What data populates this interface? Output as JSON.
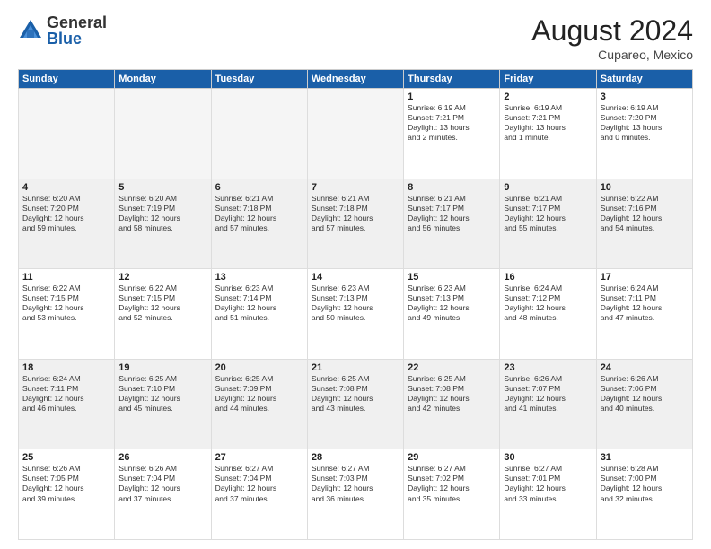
{
  "logo": {
    "general": "General",
    "blue": "Blue"
  },
  "header": {
    "month": "August 2024",
    "location": "Cupareo, Mexico"
  },
  "weekdays": [
    "Sunday",
    "Monday",
    "Tuesday",
    "Wednesday",
    "Thursday",
    "Friday",
    "Saturday"
  ],
  "weeks": [
    [
      {
        "day": "",
        "empty": true
      },
      {
        "day": "",
        "empty": true
      },
      {
        "day": "",
        "empty": true
      },
      {
        "day": "",
        "empty": true
      },
      {
        "day": "1",
        "info": "Sunrise: 6:19 AM\nSunset: 7:21 PM\nDaylight: 13 hours\nand 2 minutes."
      },
      {
        "day": "2",
        "info": "Sunrise: 6:19 AM\nSunset: 7:21 PM\nDaylight: 13 hours\nand 1 minute."
      },
      {
        "day": "3",
        "info": "Sunrise: 6:19 AM\nSunset: 7:20 PM\nDaylight: 13 hours\nand 0 minutes."
      }
    ],
    [
      {
        "day": "4",
        "info": "Sunrise: 6:20 AM\nSunset: 7:20 PM\nDaylight: 12 hours\nand 59 minutes.",
        "shaded": true
      },
      {
        "day": "5",
        "info": "Sunrise: 6:20 AM\nSunset: 7:19 PM\nDaylight: 12 hours\nand 58 minutes.",
        "shaded": true
      },
      {
        "day": "6",
        "info": "Sunrise: 6:21 AM\nSunset: 7:18 PM\nDaylight: 12 hours\nand 57 minutes.",
        "shaded": true
      },
      {
        "day": "7",
        "info": "Sunrise: 6:21 AM\nSunset: 7:18 PM\nDaylight: 12 hours\nand 57 minutes.",
        "shaded": true
      },
      {
        "day": "8",
        "info": "Sunrise: 6:21 AM\nSunset: 7:17 PM\nDaylight: 12 hours\nand 56 minutes.",
        "shaded": true
      },
      {
        "day": "9",
        "info": "Sunrise: 6:21 AM\nSunset: 7:17 PM\nDaylight: 12 hours\nand 55 minutes.",
        "shaded": true
      },
      {
        "day": "10",
        "info": "Sunrise: 6:22 AM\nSunset: 7:16 PM\nDaylight: 12 hours\nand 54 minutes.",
        "shaded": true
      }
    ],
    [
      {
        "day": "11",
        "info": "Sunrise: 6:22 AM\nSunset: 7:15 PM\nDaylight: 12 hours\nand 53 minutes."
      },
      {
        "day": "12",
        "info": "Sunrise: 6:22 AM\nSunset: 7:15 PM\nDaylight: 12 hours\nand 52 minutes."
      },
      {
        "day": "13",
        "info": "Sunrise: 6:23 AM\nSunset: 7:14 PM\nDaylight: 12 hours\nand 51 minutes."
      },
      {
        "day": "14",
        "info": "Sunrise: 6:23 AM\nSunset: 7:13 PM\nDaylight: 12 hours\nand 50 minutes."
      },
      {
        "day": "15",
        "info": "Sunrise: 6:23 AM\nSunset: 7:13 PM\nDaylight: 12 hours\nand 49 minutes."
      },
      {
        "day": "16",
        "info": "Sunrise: 6:24 AM\nSunset: 7:12 PM\nDaylight: 12 hours\nand 48 minutes."
      },
      {
        "day": "17",
        "info": "Sunrise: 6:24 AM\nSunset: 7:11 PM\nDaylight: 12 hours\nand 47 minutes."
      }
    ],
    [
      {
        "day": "18",
        "info": "Sunrise: 6:24 AM\nSunset: 7:11 PM\nDaylight: 12 hours\nand 46 minutes.",
        "shaded": true
      },
      {
        "day": "19",
        "info": "Sunrise: 6:25 AM\nSunset: 7:10 PM\nDaylight: 12 hours\nand 45 minutes.",
        "shaded": true
      },
      {
        "day": "20",
        "info": "Sunrise: 6:25 AM\nSunset: 7:09 PM\nDaylight: 12 hours\nand 44 minutes.",
        "shaded": true
      },
      {
        "day": "21",
        "info": "Sunrise: 6:25 AM\nSunset: 7:08 PM\nDaylight: 12 hours\nand 43 minutes.",
        "shaded": true
      },
      {
        "day": "22",
        "info": "Sunrise: 6:25 AM\nSunset: 7:08 PM\nDaylight: 12 hours\nand 42 minutes.",
        "shaded": true
      },
      {
        "day": "23",
        "info": "Sunrise: 6:26 AM\nSunset: 7:07 PM\nDaylight: 12 hours\nand 41 minutes.",
        "shaded": true
      },
      {
        "day": "24",
        "info": "Sunrise: 6:26 AM\nSunset: 7:06 PM\nDaylight: 12 hours\nand 40 minutes.",
        "shaded": true
      }
    ],
    [
      {
        "day": "25",
        "info": "Sunrise: 6:26 AM\nSunset: 7:05 PM\nDaylight: 12 hours\nand 39 minutes."
      },
      {
        "day": "26",
        "info": "Sunrise: 6:26 AM\nSunset: 7:04 PM\nDaylight: 12 hours\nand 37 minutes."
      },
      {
        "day": "27",
        "info": "Sunrise: 6:27 AM\nSunset: 7:04 PM\nDaylight: 12 hours\nand 37 minutes."
      },
      {
        "day": "28",
        "info": "Sunrise: 6:27 AM\nSunset: 7:03 PM\nDaylight: 12 hours\nand 36 minutes."
      },
      {
        "day": "29",
        "info": "Sunrise: 6:27 AM\nSunset: 7:02 PM\nDaylight: 12 hours\nand 35 minutes."
      },
      {
        "day": "30",
        "info": "Sunrise: 6:27 AM\nSunset: 7:01 PM\nDaylight: 12 hours\nand 33 minutes."
      },
      {
        "day": "31",
        "info": "Sunrise: 6:28 AM\nSunset: 7:00 PM\nDaylight: 12 hours\nand 32 minutes."
      }
    ]
  ]
}
